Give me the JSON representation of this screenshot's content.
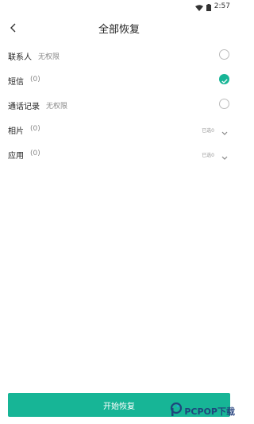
{
  "status_bar": {
    "time": "2:57"
  },
  "header": {
    "title": "全部恢复"
  },
  "rows": [
    {
      "label": "联系人",
      "sub": "无权限",
      "control": "radio",
      "checked": false
    },
    {
      "label": "短信",
      "sub": "(0)",
      "control": "radio",
      "checked": true
    },
    {
      "label": "通话记录",
      "sub": "无权限",
      "control": "radio",
      "checked": false
    },
    {
      "label": "相片",
      "sub": "(0)",
      "control": "expand",
      "selected": "已选0"
    },
    {
      "label": "应用",
      "sub": "(0)",
      "control": "expand",
      "selected": "已选0"
    }
  ],
  "footer": {
    "start_label": "开始恢复"
  },
  "watermark": {
    "text": "PCPOP下载"
  },
  "colors": {
    "accent": "#17b596"
  },
  "icons": [
    "wifi-icon",
    "battery-icon",
    "back-arrow-icon",
    "check-icon",
    "chevron-down-icon",
    "pcpop-logo-icon"
  ]
}
